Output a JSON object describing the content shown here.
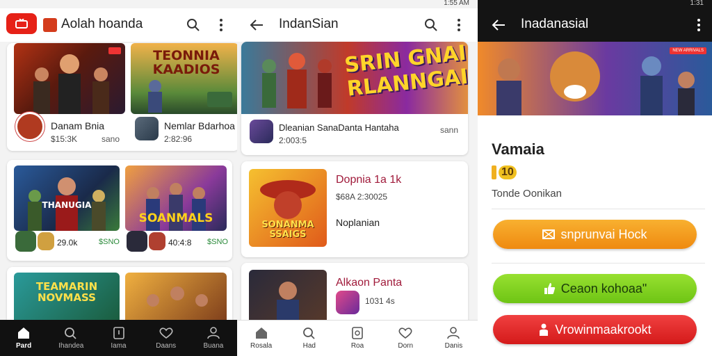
{
  "status_left": {
    "time": ""
  },
  "status_mid": {
    "time": "1:55 AM"
  },
  "status_right": {
    "time": "1:31"
  },
  "screen1": {
    "app_title": "Aolah hoanda",
    "card1": {
      "thumb_title": "TEONNIA KAADIOS",
      "name": "Danam Bnia",
      "meta1": "$15:3K",
      "meta2": "sano"
    },
    "card2": {
      "name": "Nemlar Bdarhoa",
      "meta1": "2:82:96"
    },
    "row2_left": {
      "thumb_title": "THANUGIA",
      "count": "29.0k",
      "price": "$SNO"
    },
    "row2_right": {
      "thumb_title": "SOANMALS",
      "count": "40:4:8",
      "price": "$SNO"
    },
    "row3_left": {
      "thumb_title": "TEAMARIN NOVMASS"
    },
    "nav": [
      {
        "label": "Pard",
        "icon": "home-icon"
      },
      {
        "label": "Ihandea",
        "icon": "search-icon"
      },
      {
        "label": "Iama",
        "icon": "library-icon"
      },
      {
        "label": "Daans",
        "icon": "heart-icon"
      },
      {
        "label": "Buana",
        "icon": "profile-icon"
      }
    ]
  },
  "screen2": {
    "app_title": "IndanSian",
    "hero": {
      "title_line1": "SRIN GNAI",
      "title_line2": "RLANNGAI!",
      "name": "Dleanian SanaDanta Hantaha",
      "meta": "2:003:5",
      "right": "sann"
    },
    "item1": {
      "thumb_title": "SONANMA SSAIGS",
      "name": "Dopnia 1a 1k",
      "meta": "$68A 2:30025",
      "desc": "Noplanian"
    },
    "item2": {
      "name": "Alkaon Panta",
      "meta": "1031 4s"
    },
    "nav": [
      {
        "label": "Rosala",
        "icon": "home-icon"
      },
      {
        "label": "Had",
        "icon": "search-icon"
      },
      {
        "label": "Roa",
        "icon": "library-icon"
      },
      {
        "label": "Dorn",
        "icon": "heart-icon"
      },
      {
        "label": "Danis",
        "icon": "profile-icon"
      }
    ]
  },
  "screen3": {
    "app_title": "Inadanasial",
    "banner_badge": "NEW ARRIVALS",
    "heading": "Vamaia",
    "rating": "10",
    "subtitle": "Tonde Oonikan",
    "button1": "snprunvai Hock",
    "button2": "Ceaon kohoaa\"",
    "button3": "Vrowinmaakrookt",
    "colors": {
      "orange": "#f59a1a",
      "green": "#7fd620",
      "red": "#e92a28"
    }
  }
}
